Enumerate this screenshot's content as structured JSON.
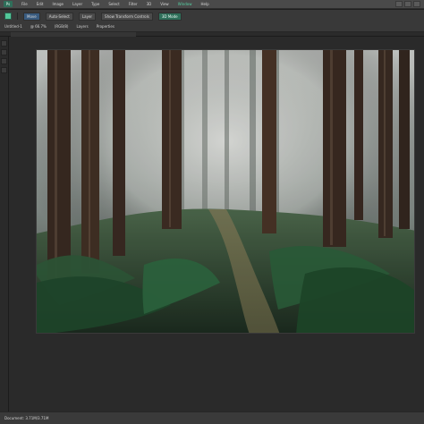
{
  "app": {
    "menu": {
      "items": [
        {
          "label": "File"
        },
        {
          "label": "Edit"
        },
        {
          "label": "Image"
        },
        {
          "label": "Layer"
        },
        {
          "label": "Type"
        },
        {
          "label": "Select"
        },
        {
          "label": "Filter"
        },
        {
          "label": "3D"
        },
        {
          "label": "View"
        },
        {
          "label": "Window"
        },
        {
          "label": "Help"
        }
      ]
    },
    "options": {
      "row1": [
        {
          "label": "Move"
        },
        {
          "label": "Auto-Select"
        },
        {
          "label": "Layer"
        },
        {
          "label": "Show Transform Controls"
        },
        {
          "label": "3D Mode"
        }
      ],
      "row2": [
        {
          "label": "Untitled-1"
        },
        {
          "label": "@ 66.7%"
        },
        {
          "label": "(RGB/8)"
        },
        {
          "label": "Layers"
        },
        {
          "label": "Properties"
        }
      ]
    },
    "status": {
      "text": "Document: 3.71M/3.71M"
    }
  },
  "colors": {
    "accent": "#53c79a",
    "background": "#2a2a2a",
    "toolbar": "#393939",
    "menubar": "#4a4a4a"
  }
}
